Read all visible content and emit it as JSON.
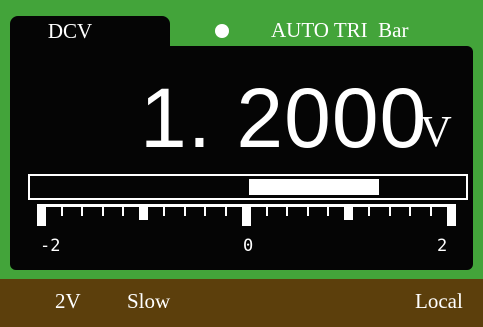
{
  "header": {
    "mode": "DCV",
    "status_text": "AUTO TRI  Bar"
  },
  "measurement": {
    "value": "1. 2000",
    "unit": "V"
  },
  "bar_graph": {
    "min": -2,
    "max": 2,
    "value": 1.2,
    "labels": [
      "-2",
      "0",
      "2"
    ]
  },
  "footer": {
    "range": "2V",
    "speed": "Slow",
    "control": "Local"
  },
  "colors": {
    "accent_green": "#43a43a",
    "display_black": "#050505",
    "footer_brown": "#5c3f0c"
  }
}
